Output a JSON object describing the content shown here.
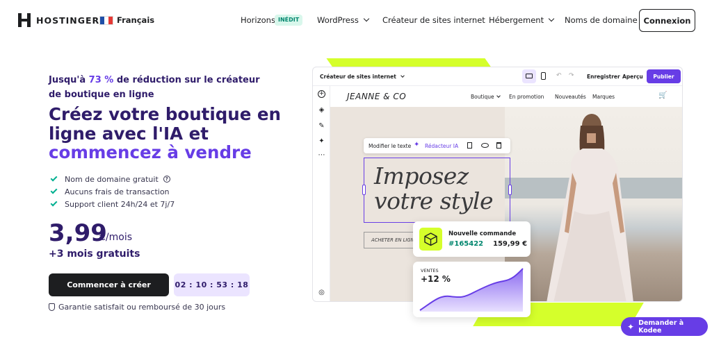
{
  "nav": {
    "brand": "HOSTINGER",
    "language": "Français",
    "links": [
      {
        "label": "Horizons"
      },
      {
        "label": "WordPress"
      },
      {
        "label": "Créateur de sites internet"
      },
      {
        "label": "Hébergement"
      },
      {
        "label": "Noms de domaine"
      }
    ],
    "new_badge": "INÉDIT",
    "login": "Connexion"
  },
  "hero": {
    "promo_prefix": "Jusqu'à ",
    "promo_percent": "73 %",
    "promo_suffix": " de réduction sur le créateur de boutique en ligne",
    "title_line1": "Créez votre boutique en ligne avec l'IA et",
    "title_line2": "commencez à vendre",
    "features": [
      "Nom de domaine gratuit",
      "Aucuns frais de transaction",
      "Support client 24h/24 et 7j/7"
    ],
    "price": "3,99",
    "price_unit": "€/mois",
    "bonus": "+3 mois gratuits",
    "cta": "Commencer à créer",
    "timer": "02 : 10 : 53 : 18",
    "guarantee": "Garantie satisfait ou remboursé de 30 jours"
  },
  "editor": {
    "builder_select": "Créateur de sites internet",
    "save": "Enregistrer",
    "preview": "Aperçu",
    "publish": "Publier",
    "site_brand": "JEANNE & CO",
    "site_nav": [
      "Boutique",
      "En promotion",
      "Nouveautés",
      "Marques"
    ],
    "toolbar_edit": "Modifier le texte",
    "toolbar_ai": "Rédacteur IA",
    "headline_line1": "Imposez",
    "headline_line2": "votre style",
    "shop_button": "ACHETER EN LIGNE",
    "order_title": "Nouvelle commande",
    "order_id": "#165422",
    "order_amount": "159,99 €",
    "sales_label": "VENTES",
    "sales_value": "+12 %"
  },
  "kodee": "Demander à Kodee",
  "colors": {
    "primary": "#673de6",
    "dark": "#1d1e20",
    "heading": "#2f1c6a",
    "lime": "#d5ff2b",
    "success": "#00b090"
  }
}
